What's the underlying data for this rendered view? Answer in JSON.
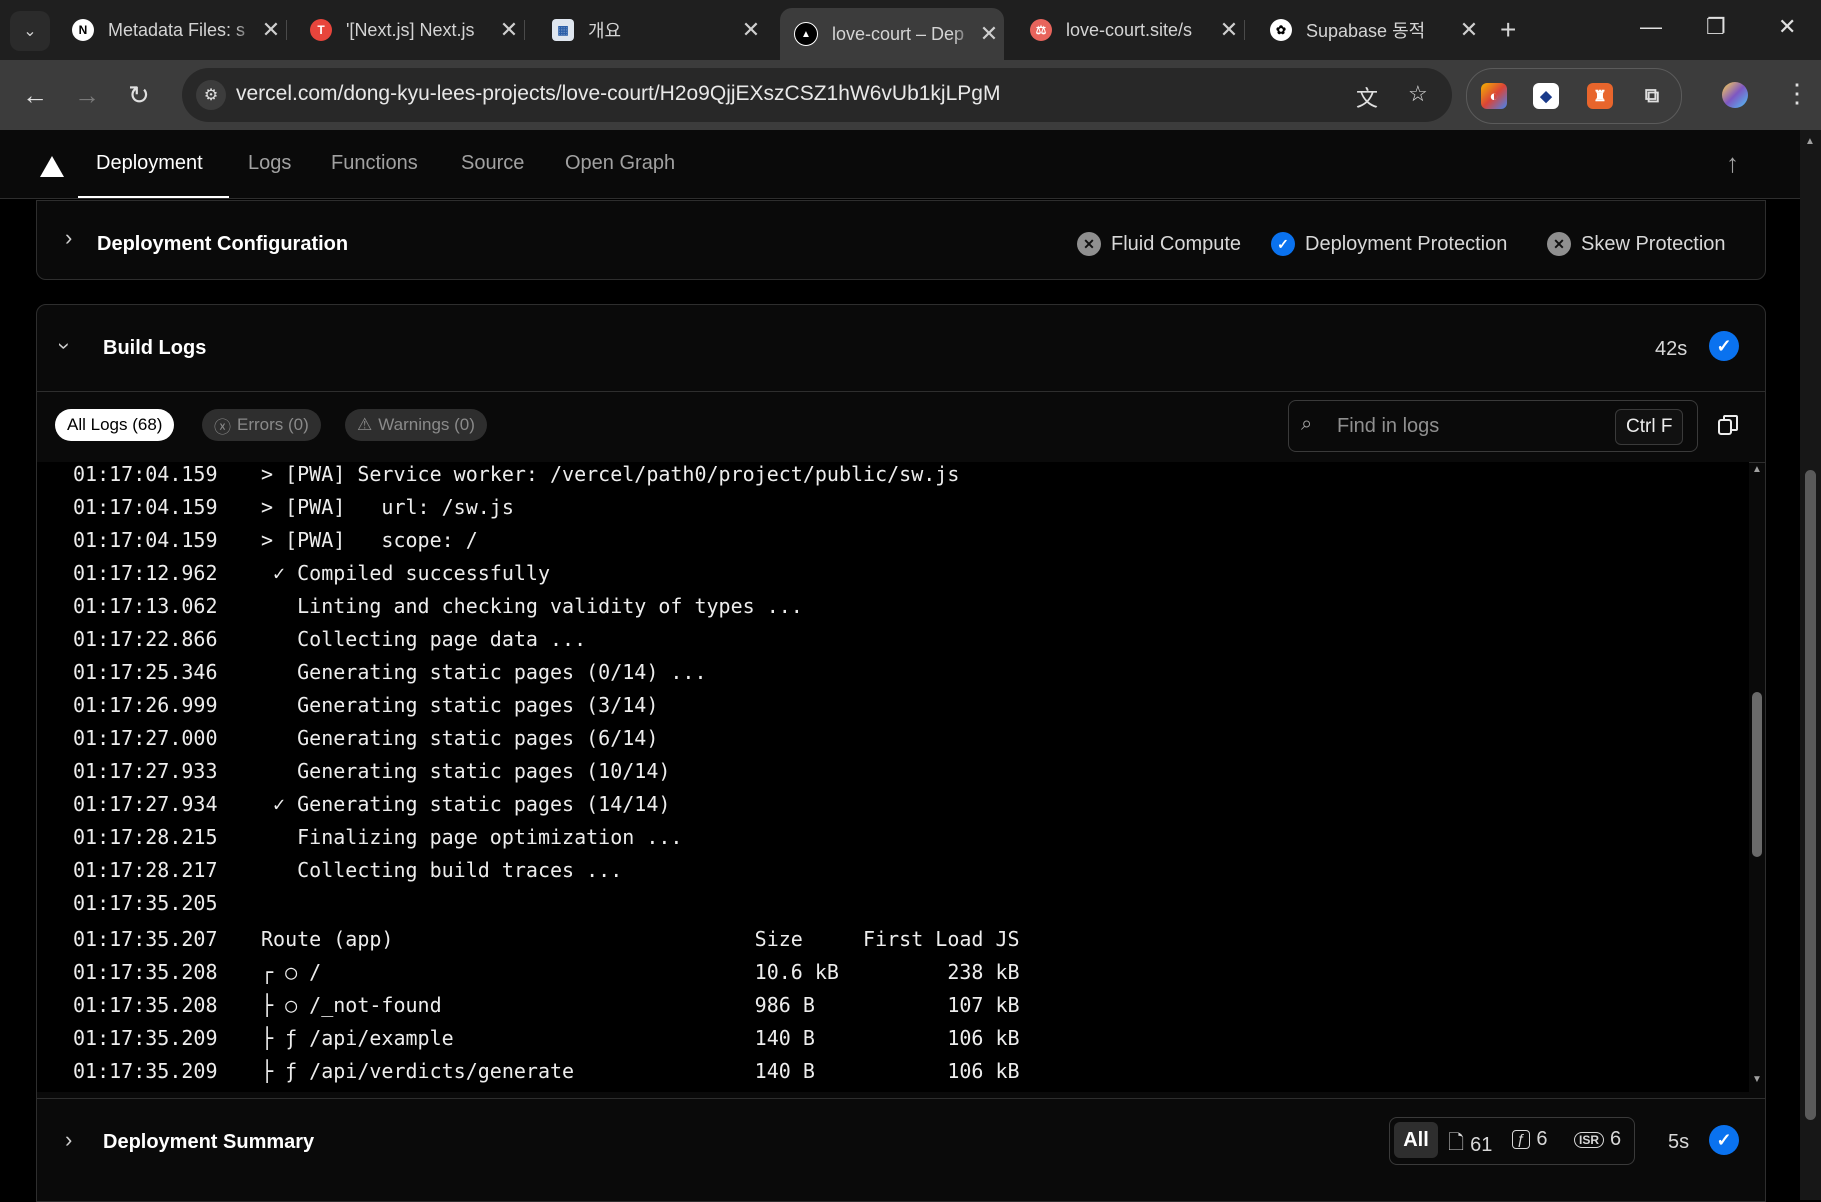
{
  "browser": {
    "tabs": [
      {
        "title": "Metadata Files: s",
        "favicon": "next-icon"
      },
      {
        "title": "'[Next.js] Next.js",
        "favicon": "tistory-icon"
      },
      {
        "title": "개요",
        "favicon": "calendar-icon"
      },
      {
        "title": "love-court – Dep",
        "favicon": "vercel-icon",
        "active": true
      },
      {
        "title": "love-court.site/s",
        "favicon": "site-icon"
      },
      {
        "title": "Supabase 동적",
        "favicon": "openai-icon"
      }
    ],
    "url": "vercel.com/dong-kyu-lees-projects/love-court/H2o9QjjEXszCSZ1hW6vUb1kjLPgM"
  },
  "vercel_nav": {
    "tabs": [
      "Deployment",
      "Logs",
      "Functions",
      "Source",
      "Open Graph"
    ],
    "active": "Deployment"
  },
  "deployment_config": {
    "title": "Deployment Configuration",
    "features": [
      {
        "label": "Fluid Compute",
        "enabled": false
      },
      {
        "label": "Deployment Protection",
        "enabled": true
      },
      {
        "label": "Skew Protection",
        "enabled": false
      }
    ]
  },
  "build_logs": {
    "title": "Build Logs",
    "duration": "42s",
    "filters": {
      "all": "All Logs (68)",
      "errors": "Errors (0)",
      "warnings": "Warnings (0)"
    },
    "search_placeholder": "Find in logs",
    "shortcut": "Ctrl F",
    "lines": [
      {
        "ts": "01:17:04.159",
        "msg": "> [PWA] Service worker: /vercel/path0/project/public/sw.js"
      },
      {
        "ts": "01:17:04.159",
        "msg": "> [PWA]   url: /sw.js"
      },
      {
        "ts": "01:17:04.159",
        "msg": "> [PWA]   scope: /"
      },
      {
        "ts": "01:17:12.962",
        "msg": " ✓ Compiled successfully"
      },
      {
        "ts": "01:17:13.062",
        "msg": "   Linting and checking validity of types ..."
      },
      {
        "ts": "01:17:22.866",
        "msg": "   Collecting page data ..."
      },
      {
        "ts": "01:17:25.346",
        "msg": "   Generating static pages (0/14) ..."
      },
      {
        "ts": "01:17:26.999",
        "msg": "   Generating static pages (3/14)"
      },
      {
        "ts": "01:17:27.000",
        "msg": "   Generating static pages (6/14)"
      },
      {
        "ts": "01:17:27.933",
        "msg": "   Generating static pages (10/14)"
      },
      {
        "ts": "01:17:27.934",
        "msg": " ✓ Generating static pages (14/14)"
      },
      {
        "ts": "01:17:28.215",
        "msg": "   Finalizing page optimization ..."
      },
      {
        "ts": "01:17:28.217",
        "msg": "   Collecting build traces ..."
      },
      {
        "ts": "01:17:35.205",
        "msg": ""
      },
      {
        "ts": "01:17:35.207",
        "msg": "Route (app)                              Size     First Load JS"
      },
      {
        "ts": "01:17:35.208",
        "msg": "┌ ○ /                                    10.6 kB         238 kB"
      },
      {
        "ts": "01:17:35.208",
        "msg": "├ ○ /_not-found                          986 B           107 kB"
      },
      {
        "ts": "01:17:35.209",
        "msg": "├ ƒ /api/example                         140 B           106 kB"
      },
      {
        "ts": "01:17:35.209",
        "msg": "├ ƒ /api/verdicts/generate               140 B           106 kB"
      }
    ]
  },
  "deployment_summary": {
    "title": "Deployment Summary",
    "all_label": "All",
    "static_count": "61",
    "function_count": "6",
    "isr_label": "ISR",
    "isr_count": "6",
    "duration": "5s"
  }
}
